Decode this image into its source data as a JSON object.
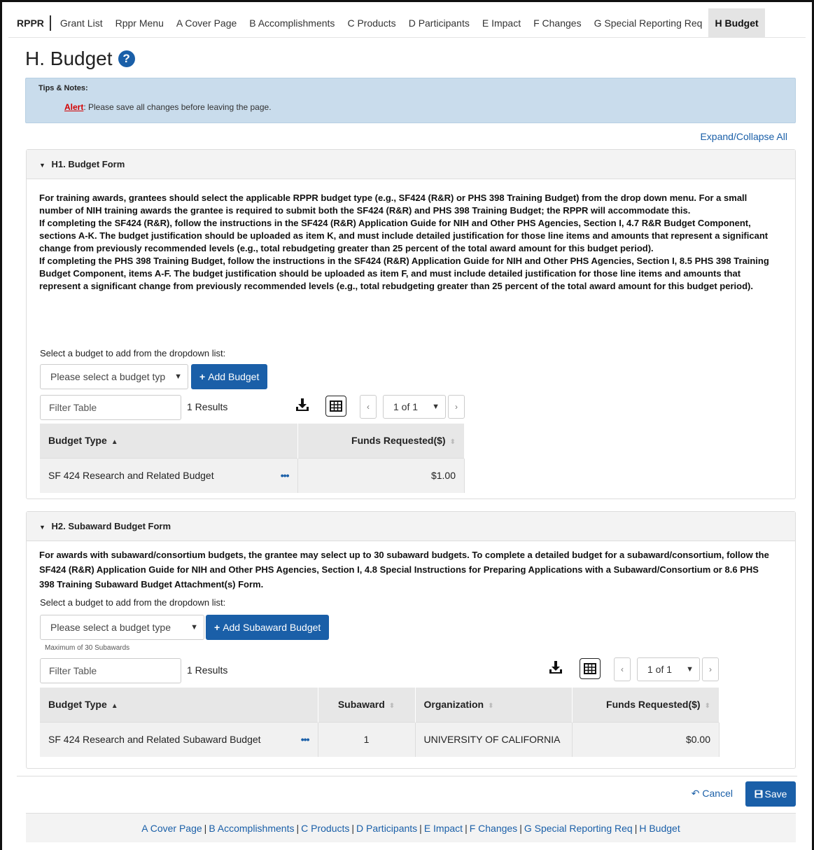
{
  "topnav": {
    "brand": "RPPR",
    "items": [
      "Grant List",
      "Rppr Menu",
      "A Cover Page",
      "B Accomplishments",
      "C Products",
      "D Participants",
      "E Impact",
      "F Changes",
      "G Special Reporting Req",
      "H Budget"
    ]
  },
  "page": {
    "title": "H. Budget",
    "help_icon_glyph": "?"
  },
  "tips": {
    "title": "Tips & Notes:",
    "alert_label": "Alert",
    "alert_text": ": Please save all changes before leaving the page."
  },
  "expand_collapse": "Expand/Collapse All",
  "h1": {
    "header": "H1. Budget Form",
    "paragraphs": [
      "For training awards, grantees should select the applicable RPPR budget type (e.g., SF424 (R&R) or PHS 398 Training Budget) from the drop down menu. For a small number of NIH training awards the grantee is required to submit both the SF424 (R&R) and PHS 398 Training Budget; the RPPR will accommodate this.",
      "If completing the SF424 (R&R), follow the instructions in the SF424 (R&R) Application Guide for NIH and Other PHS Agencies, Section I, 4.7 R&R Budget Component, sections A-K. The budget justification should be uploaded as item K, and must include detailed justification for those line items and amounts that represent a significant change from previously recommended levels (e.g., total rebudgeting greater than 25 percent of the total award amount for this budget period).",
      "If completing the PHS 398 Training Budget, follow the instructions in the SF424 (R&R) Application Guide for NIH and Other PHS Agencies, Section I, 8.5 PHS 398 Training Budget Component, items A-F. The budget justification should be uploaded as item F, and must include detailed justification for those line items and amounts that represent a significant change from previously recommended levels (e.g., total rebudgeting greater than 25 percent of the total award amount for this budget period)."
    ],
    "select_label": "Select a budget to add from the dropdown list:",
    "select_value": "Please select a budget typ",
    "add_button": "Add Budget",
    "filter_placeholder": "Filter Table",
    "results": "1 Results",
    "pager": "1 of 1",
    "columns": [
      "Budget Type",
      "Funds Requested($)"
    ],
    "rows": [
      {
        "budget_type": "SF 424 Research and Related Budget",
        "funds": "$1.00"
      }
    ]
  },
  "h2": {
    "header": "H2. Subaward Budget Form",
    "paragraph": "For awards with subaward/consortium budgets, the grantee may select up to 30 subaward budgets. To complete a detailed budget for a subaward/consortium, follow the SF424 (R&R) Application Guide for NIH and Other PHS Agencies, Section I, 4.8 Special Instructions for Preparing Applications with a Subaward/Consortium or 8.6 PHS 398 Training Subaward Budget Attachment(s) Form.",
    "select_label": "Select a budget to add from the dropdown list:",
    "select_value": "Please select a budget type",
    "add_button": "Add Subaward Budget",
    "max_note": "Maximum of 30 Subawards",
    "filter_placeholder": "Filter Table",
    "results": "1 Results",
    "pager": "1 of 1",
    "columns": [
      "Budget Type",
      "Subaward",
      "Organization",
      "Funds Requested($)"
    ],
    "rows": [
      {
        "budget_type": "SF 424 Research and Related Subaward Budget",
        "subaward": "1",
        "organization": "UNIVERSITY OF CALIFORNIA",
        "funds": "$0.00"
      }
    ]
  },
  "actions": {
    "cancel": "Cancel",
    "save": "Save"
  },
  "bottom_nav": [
    "A Cover Page",
    "B Accomplishments",
    "C Products",
    "D Participants",
    "E Impact",
    "F Changes",
    "G Special Reporting Req",
    "H Budget"
  ],
  "colors": {
    "primary": "#1a5fa8",
    "tips_bg": "#c9dcec",
    "alert": "#d40000"
  }
}
